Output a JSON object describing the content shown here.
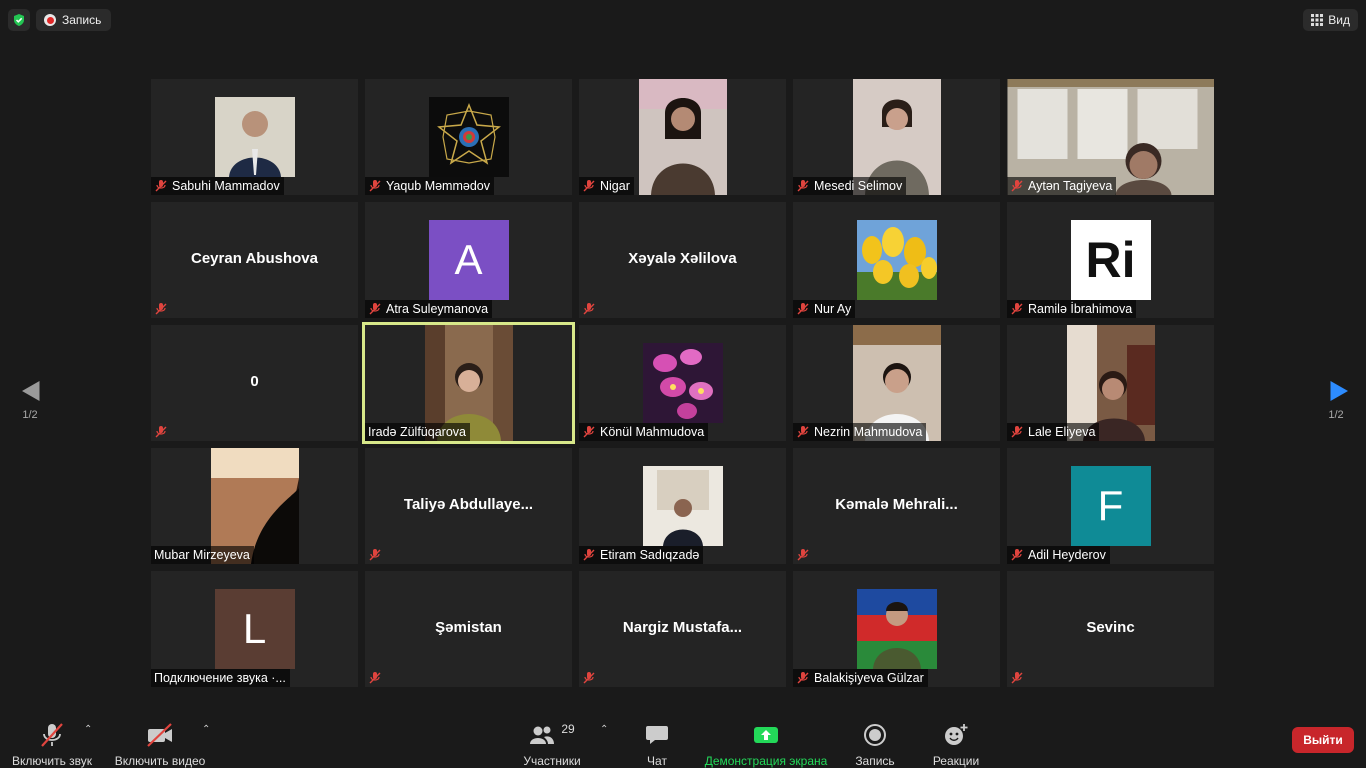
{
  "topbar": {
    "recording_label": "Запись",
    "view_label": "Вид"
  },
  "pager": {
    "left_label": "1/2",
    "right_label": "1/2"
  },
  "tiles": [
    {
      "name": "Sabuhi Mammadov"
    },
    {
      "name": "Yaqub Məmmədov"
    },
    {
      "name": "Nigar"
    },
    {
      "name": "Mesedi Selimov"
    },
    {
      "name": "Aytən Tagiyeva"
    },
    {
      "name": "Ceyran Abushova"
    },
    {
      "name": "Atra Suleymanova",
      "avatar_letter": "A",
      "avatar_color": "#7b4fc4"
    },
    {
      "name": "Xəyalə Xəlilova"
    },
    {
      "name": "Nur Ay"
    },
    {
      "name": "Ramilə İbrahimova",
      "avatar_text": "Ri"
    },
    {
      "name": "0"
    },
    {
      "name": "Iradə Zülfüqarova"
    },
    {
      "name": "Könül Mahmudova"
    },
    {
      "name": "Nezrin Mahmudova"
    },
    {
      "name": "Lale Eliyeva"
    },
    {
      "name": "Mubar Mirzeyeva"
    },
    {
      "name": "Taliyə  Abdullaye..."
    },
    {
      "name": "Etiram Sadıqzadə"
    },
    {
      "name": "Kəmalə  Mehrali..."
    },
    {
      "name": "Adil Heyderov",
      "avatar_letter": "F",
      "avatar_color": "#0f8b96"
    },
    {
      "name": "Подключение звука ·...",
      "avatar_letter": "L",
      "avatar_color": "#5a3d33"
    },
    {
      "name": "Şəmistan"
    },
    {
      "name": "Nargiz  Mustafa..."
    },
    {
      "name": "Balakişiyeva Gülzar"
    },
    {
      "name": "Sevinc"
    }
  ],
  "toolbar": {
    "audio_label": "Включить звук",
    "video_label": "Включить видео",
    "participants_label": "Участники",
    "participants_count": "29",
    "chat_label": "Чат",
    "share_label": "Демонстрация экрана",
    "record_label": "Запись",
    "reactions_label": "Реакции",
    "leave_label": "Выйти"
  },
  "colors": {
    "share_accent": "#23d959",
    "leave": "#c8262b",
    "active_outline": "#d8e88a"
  }
}
